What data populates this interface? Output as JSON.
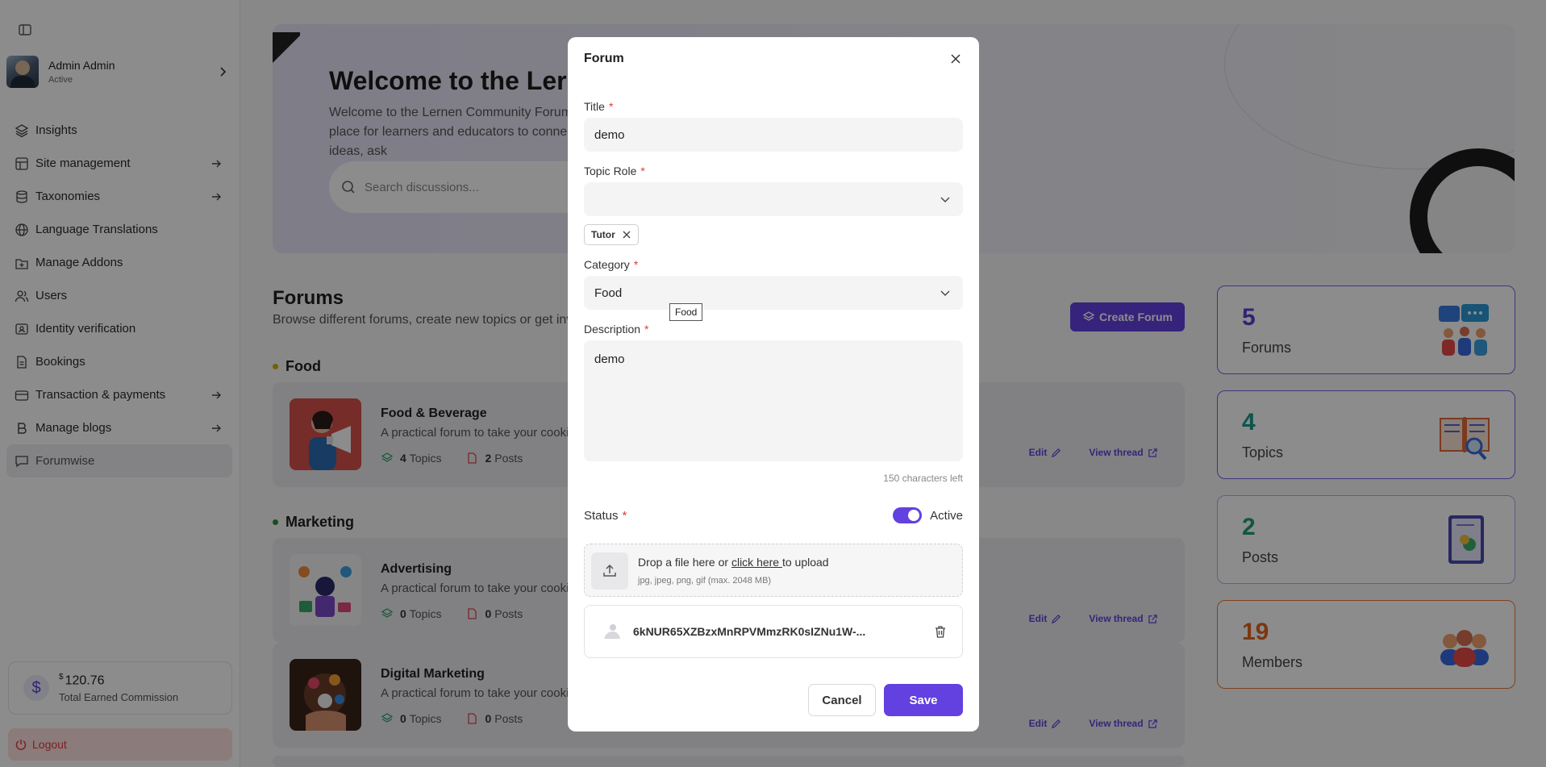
{
  "sidebar": {
    "user": {
      "name": "Admin Admin",
      "status": "Active"
    },
    "items": [
      {
        "label": "Insights",
        "icon": "layers-icon"
      },
      {
        "label": "Site management",
        "icon": "layout-icon"
      },
      {
        "label": "Taxonomies",
        "icon": "database-icon"
      },
      {
        "label": "Language Translations",
        "icon": "globe-icon"
      },
      {
        "label": "Manage Addons",
        "icon": "addon-icon"
      },
      {
        "label": "Users",
        "icon": "users-icon"
      },
      {
        "label": "Identity verification",
        "icon": "id-card-icon"
      },
      {
        "label": "Bookings",
        "icon": "document-icon"
      },
      {
        "label": "Transaction & payments",
        "icon": "credit-card-icon"
      },
      {
        "label": "Manage blogs",
        "icon": "bold-b-icon"
      },
      {
        "label": "Forumwise",
        "icon": "chat-icon"
      }
    ],
    "commission": {
      "currency": "$",
      "amount": "120.76",
      "label": "Total Earned Commission"
    },
    "logout_label": "Logout"
  },
  "hero": {
    "title": "Welcome to the Lernen Community Forums",
    "subtitle": "Welcome to the Lernen Community Forum, a place for learners and educators to connect, share ideas, ask",
    "search_placeholder": "Search discussions..."
  },
  "forums": {
    "title": "Forums",
    "subtitle": "Browse different forums, create new topics or get involved in existing discussions.",
    "create_label": "Create Forum",
    "categories": [
      {
        "name": "Food",
        "color": "#d4b106",
        "items": [
          {
            "name": "Food & Beverage",
            "desc": "A practical forum to take your cooking skills to the next level.",
            "topics": "4",
            "posts": "2"
          }
        ]
      },
      {
        "name": "Marketing",
        "color": "#2e8b3a",
        "items": [
          {
            "name": "Advertising",
            "desc": "A practical forum to take your cooking skills to the next level.",
            "topics": "0",
            "posts": "0"
          },
          {
            "name": "Digital Marketing",
            "desc": "A practical forum to take your cooking skills to the next level.",
            "topics": "0",
            "posts": "0"
          }
        ]
      }
    ],
    "topics_word": "Topics",
    "posts_word": "Posts",
    "edit_label": "Edit",
    "view_label": "View thread"
  },
  "stats": [
    {
      "value": "5",
      "label": "Forums",
      "color": "#5b3fd6",
      "border": "#7a5de8"
    },
    {
      "value": "4",
      "label": "Topics",
      "color": "#1a9a8c",
      "border": "#7a5de8"
    },
    {
      "value": "2",
      "label": "Posts",
      "color": "#1fa06a",
      "border": "#b7a6f0"
    },
    {
      "value": "19",
      "label": "Members",
      "color": "#e0651e",
      "border": "#e8773a"
    }
  ],
  "modal": {
    "title": "Forum",
    "title_label": "Title",
    "title_value": "demo",
    "topic_role_label": "Topic Role",
    "topic_role_value": "",
    "topic_role_chip": "Tutor",
    "category_label": "Category",
    "category_value": "Food",
    "category_tooltip": "Food",
    "description_label": "Description",
    "description_value": "demo",
    "chars_left": "150 characters left",
    "status_label": "Status",
    "status_value": "Active",
    "status_on": true,
    "upload_text_before": "Drop a file here or ",
    "upload_link": "click here ",
    "upload_text_after": "to upload",
    "upload_hint": "jpg, jpeg, png, gif (max. 2048 MB)",
    "file_name": "6kNUR65XZBzxMnRPVMmzRK0sIZNu1W-...",
    "cancel_label": "Cancel",
    "save_label": "Save"
  }
}
